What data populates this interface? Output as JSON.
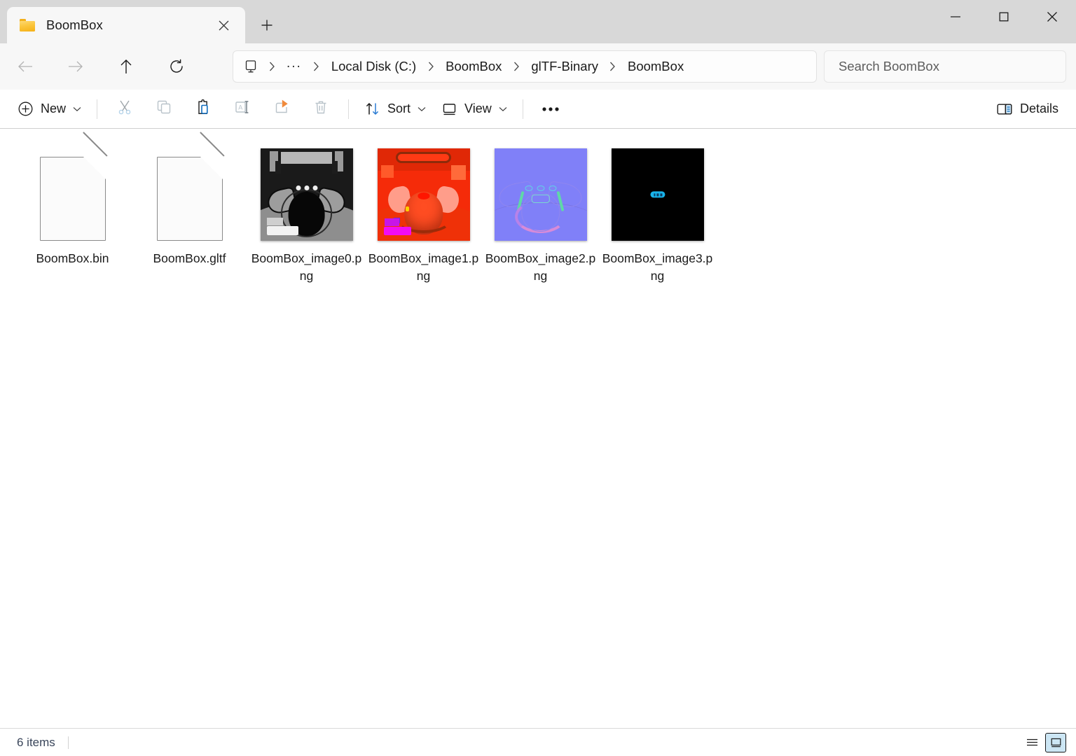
{
  "window": {
    "titlebar_bg": "#d8d8d8",
    "controls": [
      {
        "name": "minimize",
        "label": "Minimize"
      },
      {
        "name": "maximize",
        "label": "Maximize"
      },
      {
        "name": "close",
        "label": "Close"
      }
    ]
  },
  "tab": {
    "title": "BoomBox",
    "icon": "folder-icon",
    "close_icon": "close-icon",
    "new_tab_icon": "plus-icon",
    "new_tab_label": "Add new tab"
  },
  "nav": {
    "back": {
      "icon": "arrow-left-icon",
      "label": "Back",
      "enabled": false
    },
    "forward": {
      "icon": "arrow-right-icon",
      "label": "Forward",
      "enabled": false
    },
    "up": {
      "icon": "arrow-up-icon",
      "label": "Up to BoomBox",
      "enabled": true
    },
    "refresh": {
      "icon": "refresh-icon",
      "label": "Refresh",
      "enabled": true
    }
  },
  "breadcrumb": {
    "root_icon": "monitor-icon",
    "overflow": "...",
    "separator": "chevron-right-icon",
    "items": [
      "Local Disk (C:)",
      "BoomBox",
      "glTF-Binary",
      "BoomBox"
    ]
  },
  "search": {
    "placeholder": "Search BoomBox",
    "value": ""
  },
  "toolbar": {
    "new_label": "New",
    "new_icon": "plus-circle-icon",
    "cut_icon": "scissors-icon",
    "copy_icon": "copy-icon",
    "paste_icon": "clipboard-paste-icon",
    "rename_icon": "rename-icon",
    "share_icon": "share-icon",
    "delete_icon": "trash-icon",
    "sort_label": "Sort",
    "sort_icon": "sort-arrows-icon",
    "view_label": "View",
    "view_icon": "monitor-icon",
    "more_label": "See more",
    "more_icon": "ellipsis-icon",
    "details_label": "Details",
    "details_icon": "details-pane-icon",
    "accent_color": "#0f6cbd"
  },
  "files": [
    {
      "name": "BoomBox.bin",
      "kind": "generic-file",
      "thumb": "doc"
    },
    {
      "name": "BoomBox.gltf",
      "kind": "generic-file",
      "thumb": "doc"
    },
    {
      "name": "BoomBox_image0.png",
      "kind": "png-image",
      "thumb": "t0"
    },
    {
      "name": "BoomBox_image1.png",
      "kind": "png-image",
      "thumb": "t1"
    },
    {
      "name": "BoomBox_image2.png",
      "kind": "png-image",
      "thumb": "t2"
    },
    {
      "name": "BoomBox_image3.png",
      "kind": "png-image",
      "thumb": "t3"
    }
  ],
  "status": {
    "item_count": "6 items",
    "list_view_icon": "list-view-icon",
    "list_view_label": "Details view",
    "thumb_view_icon": "large-icons-view-icon",
    "thumb_view_label": "Large icons view",
    "active_view": "thumbnails",
    "selected_highlight": "#cce6f4"
  }
}
